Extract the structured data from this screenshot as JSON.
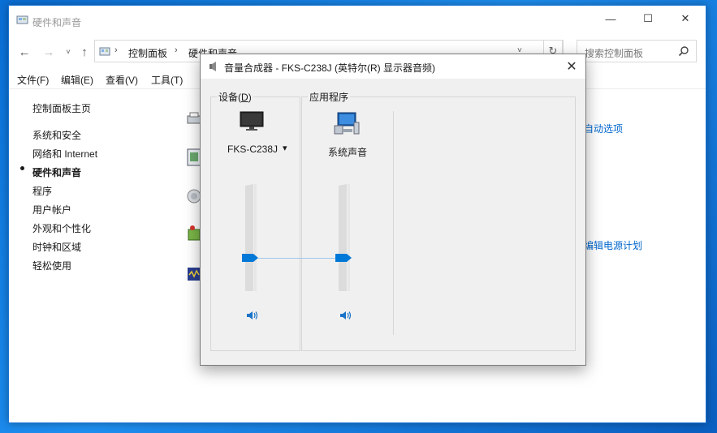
{
  "window": {
    "title": "硬件和声音",
    "controls": {
      "minimize": "—",
      "maximize": "☐",
      "close": "✕"
    }
  },
  "address": {
    "crumbs": [
      "控制面板",
      "硬件和声音"
    ],
    "refresh_icon": "refresh-icon",
    "search_placeholder": "搜索控制面板"
  },
  "menu": [
    "文件(F)",
    "编辑(E)",
    "查看(V)",
    "工具(T)"
  ],
  "sidebar": {
    "items": [
      {
        "label": "控制面板主页",
        "current": false
      },
      {
        "label": "系统和安全",
        "current": false
      },
      {
        "label": "网络和 Internet",
        "current": false
      },
      {
        "label": "硬件和声音",
        "current": true
      },
      {
        "label": "程序",
        "current": false
      },
      {
        "label": "用户帐户",
        "current": false
      },
      {
        "label": "外观和个性化",
        "current": false
      },
      {
        "label": "时钟和区域",
        "current": false
      },
      {
        "label": "轻松使用",
        "current": false
      }
    ]
  },
  "main": {
    "partial_links": [
      "自动选项",
      "编辑电源计划"
    ]
  },
  "mixer": {
    "title": "音量合成器 - FKS-C238J (英特尔(R) 显示器音频)",
    "device_group_label": "设备",
    "device_group_accel": "D",
    "apps_group_label": "应用程序",
    "device": {
      "name": "FKS-C238J",
      "dropdown_arrow": "▾",
      "level": 0.3
    },
    "apps": [
      {
        "name": "系统声音",
        "level": 0.3
      }
    ],
    "close": "✕"
  },
  "colors": {
    "accent": "#0078d7",
    "link": "#0066cc"
  }
}
